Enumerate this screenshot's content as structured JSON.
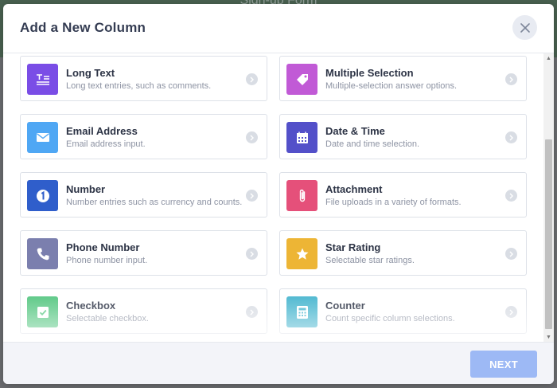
{
  "backdrop": {
    "title": "Sign-up Form"
  },
  "modal": {
    "title": "Add a New Column",
    "close_icon": "close-icon",
    "next_label": "NEXT"
  },
  "colors": {
    "next_button": "#9db9f5",
    "title": "#343c52"
  },
  "column_types": [
    {
      "label": "Long Text",
      "description": "Long text entries, such as comments.",
      "icon": "long-text-icon",
      "color": "#7a4de6"
    },
    {
      "label": "Multiple Selection",
      "description": "Multiple-selection answer options.",
      "icon": "tag-icon",
      "color": "#c15ad6"
    },
    {
      "label": "Email Address",
      "description": "Email address input.",
      "icon": "envelope-icon",
      "color": "#4fa7f4"
    },
    {
      "label": "Date & Time",
      "description": "Date and time selection.",
      "icon": "calendar-icon",
      "color": "#5350c9"
    },
    {
      "label": "Number",
      "description": "Number entries such as currency and counts.",
      "icon": "number-icon",
      "color": "#2f5ecb"
    },
    {
      "label": "Attachment",
      "description": "File uploads in a variety of formats.",
      "icon": "paperclip-icon",
      "color": "#e5507a"
    },
    {
      "label": "Phone Number",
      "description": "Phone number input.",
      "icon": "phone-icon",
      "color": "#7b7fae"
    },
    {
      "label": "Star Rating",
      "description": "Selectable star ratings.",
      "icon": "star-icon",
      "color": "#edb535"
    },
    {
      "label": "Checkbox",
      "description": "Selectable checkbox.",
      "icon": "checkbox-icon",
      "color": "#58c783"
    },
    {
      "label": "Counter",
      "description": "Count specific column selections.",
      "icon": "calculator-icon",
      "color": "#48b6cf"
    }
  ]
}
